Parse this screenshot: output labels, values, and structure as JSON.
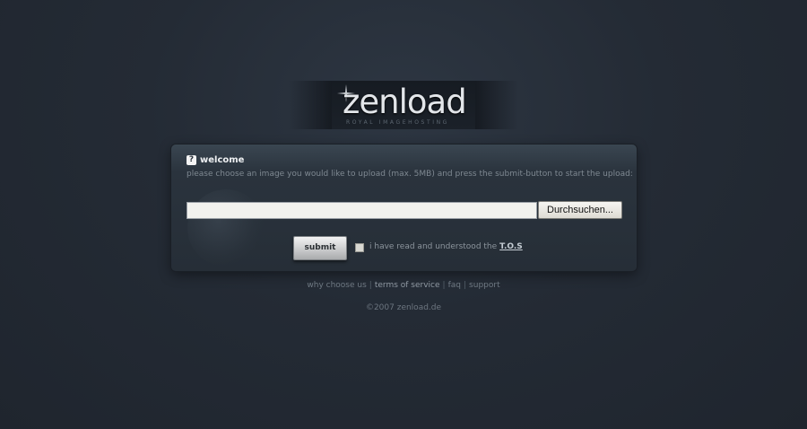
{
  "logo": {
    "name": "zenload",
    "tagline": "ROYAL IMAGEHOSTING"
  },
  "panel": {
    "title": "welcome",
    "description": "please choose an image you would like to upload (max. 5MB) and press the submit-button to start the upload:",
    "file_input_value": "",
    "browse_label": "Durchsuchen...",
    "submit_label": "submit",
    "tos_text": "i have read and understood the",
    "tos_link": "T.O.S",
    "tos_checked": false
  },
  "footer": {
    "links": [
      {
        "label": "why choose us"
      },
      {
        "label": "terms of service"
      },
      {
        "label": "faq"
      },
      {
        "label": "support"
      }
    ],
    "copyright": "©2007 zenload.de"
  },
  "colors": {
    "background": "#242b35",
    "panel": "#2a333d",
    "accent_text": "#eef0f2"
  }
}
